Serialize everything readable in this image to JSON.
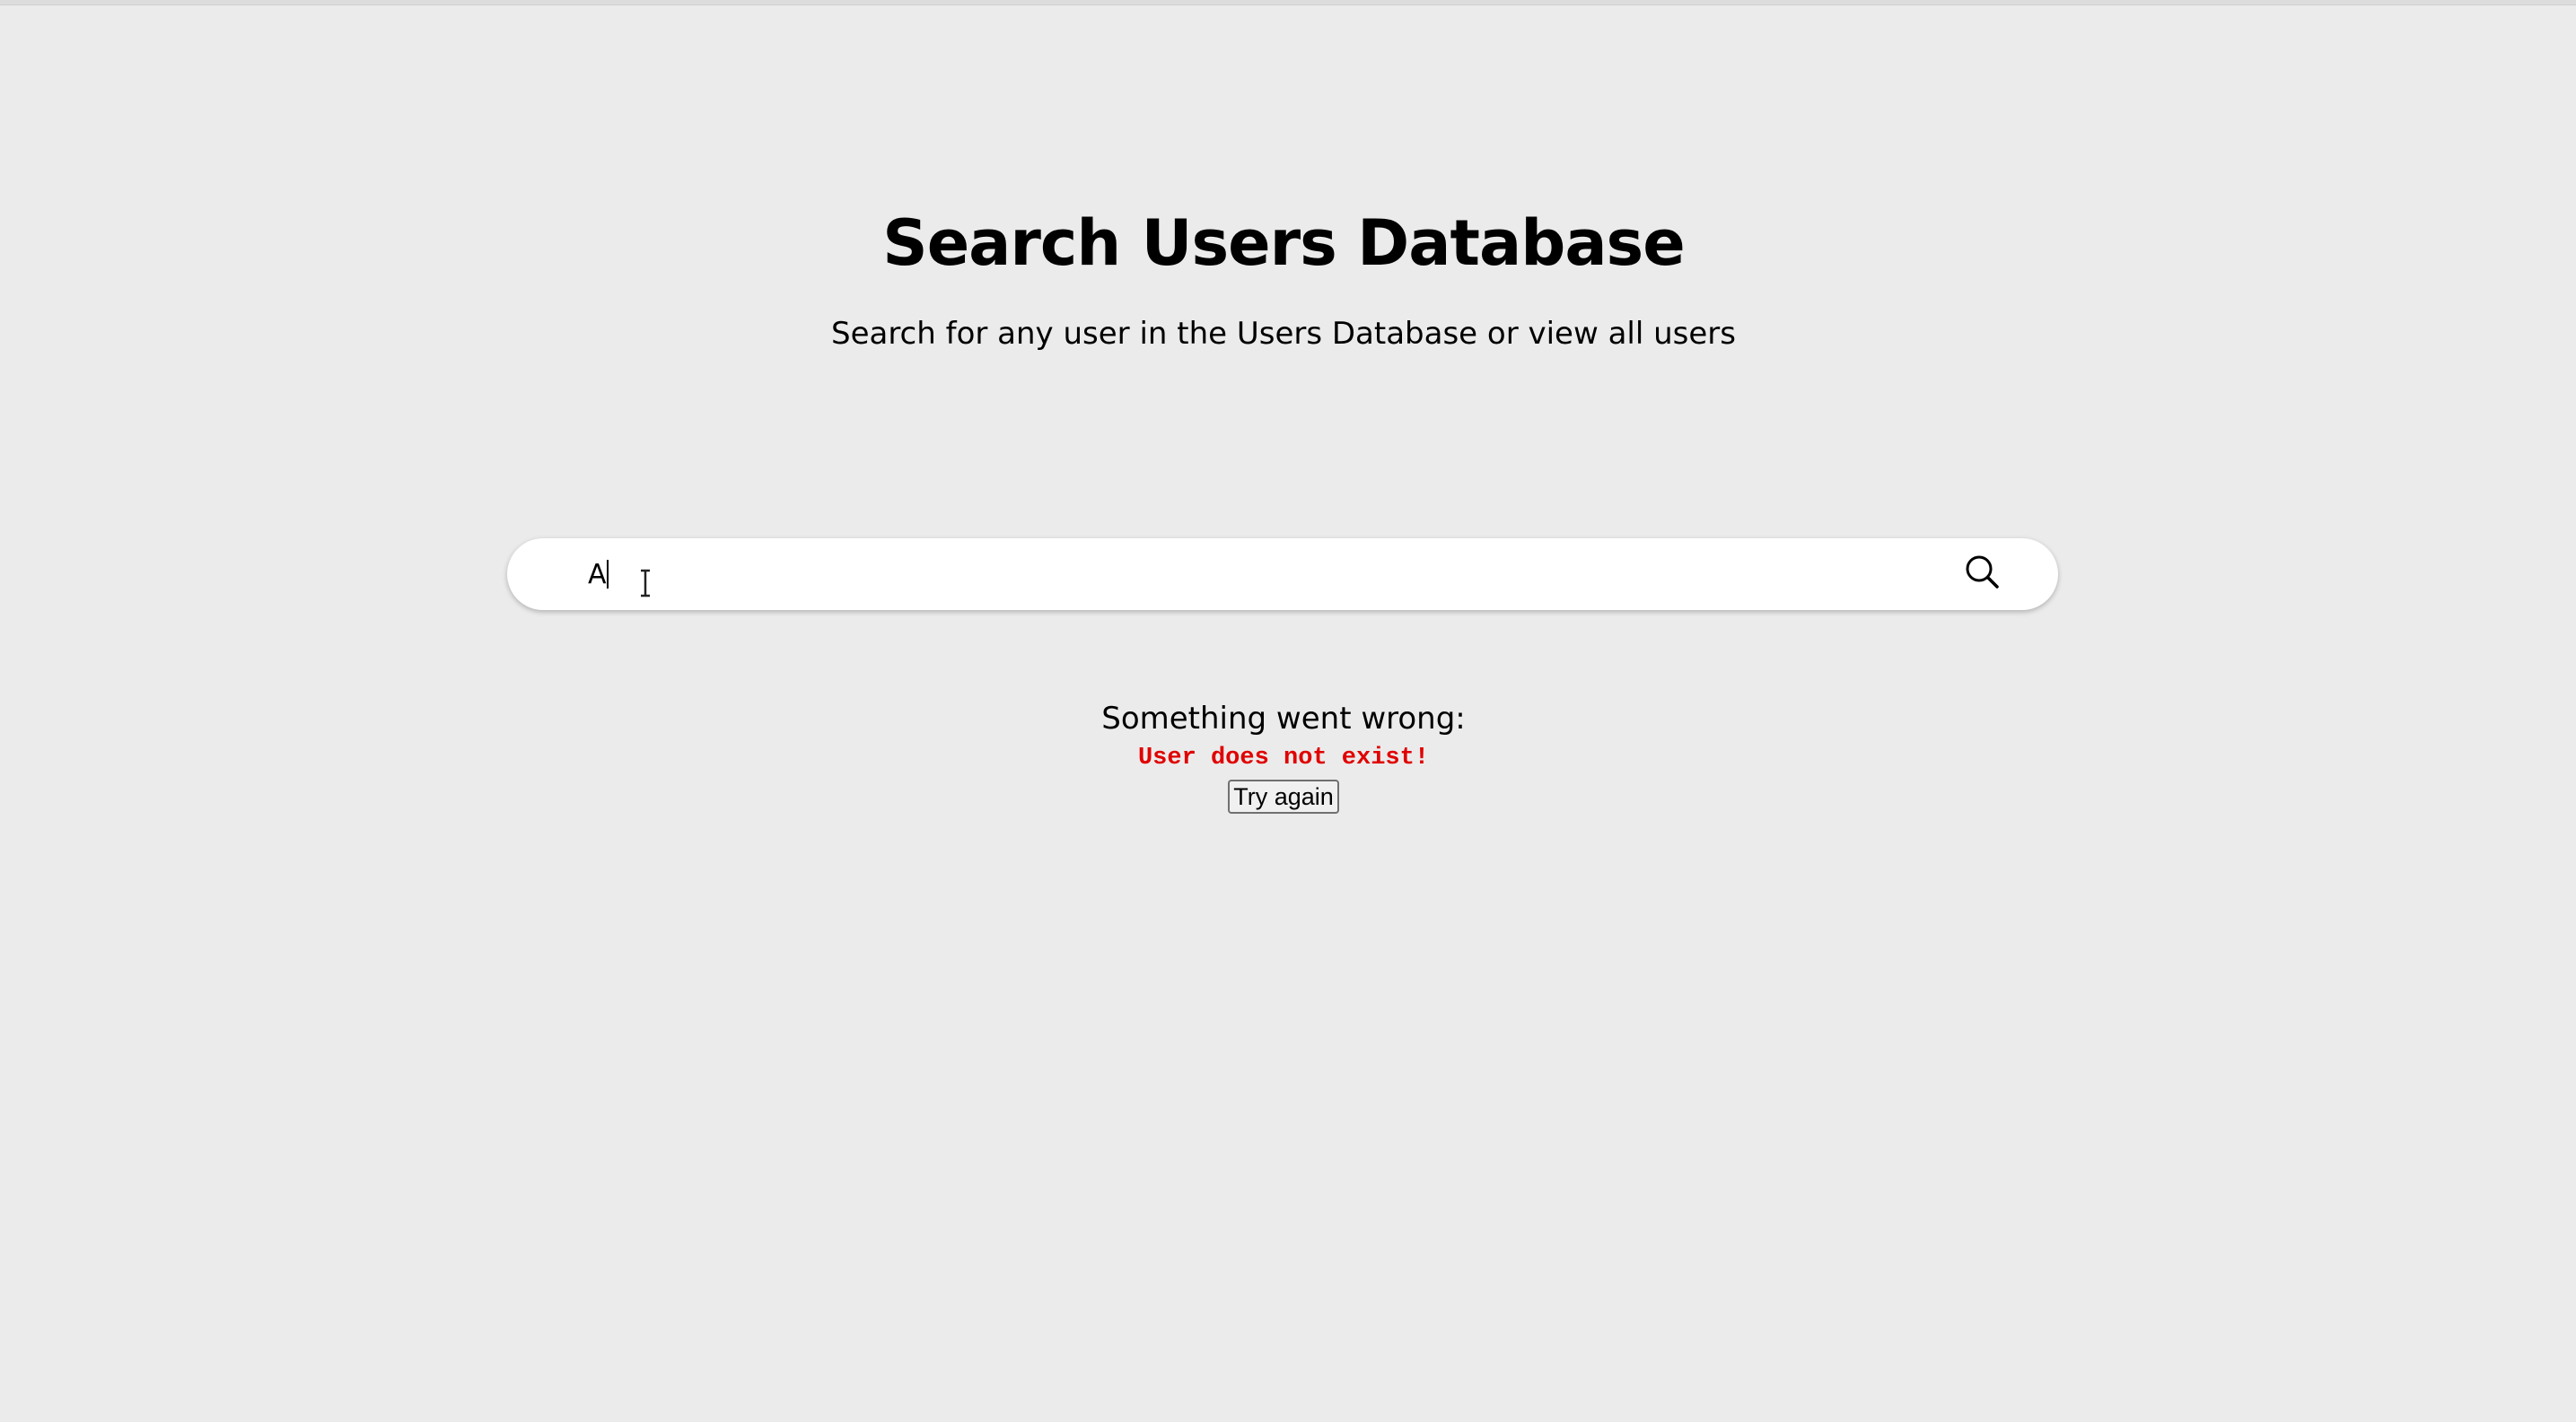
{
  "header": {
    "title": "Search Users Database",
    "subtitle": "Search for any user in the Users Database or view all users"
  },
  "search": {
    "value": "A",
    "icon": "search-icon"
  },
  "error": {
    "heading": "Something went wrong:",
    "message": "User does not exist!",
    "retry_label": "Try again",
    "message_color": "#e00000"
  }
}
